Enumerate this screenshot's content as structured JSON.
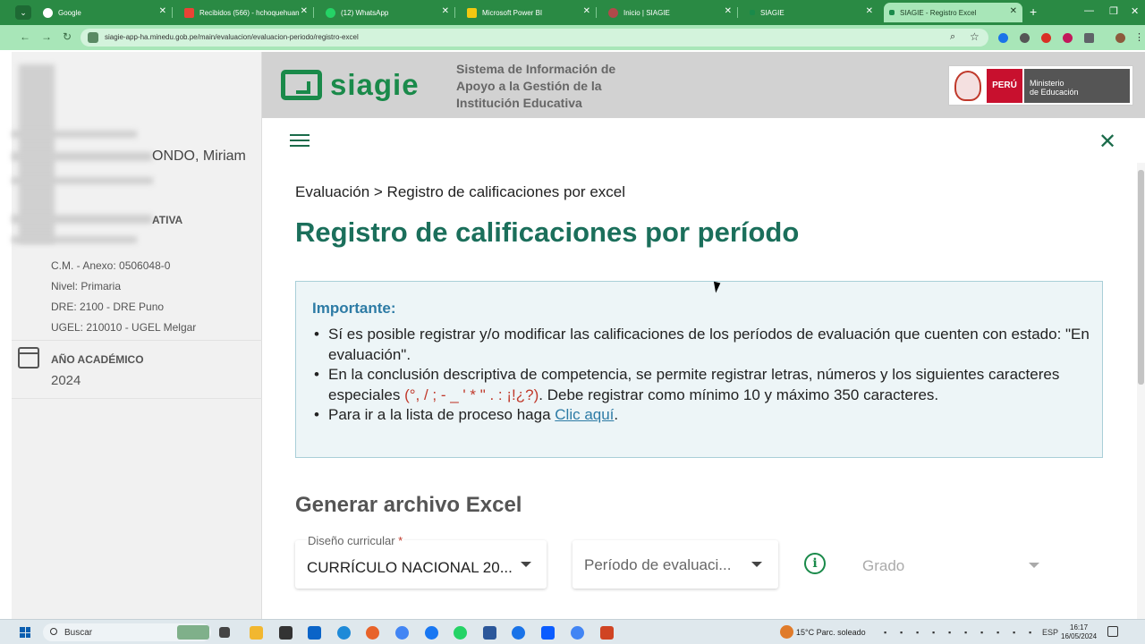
{
  "browser": {
    "tabs": [
      {
        "label": "Google",
        "color": "#4285f4"
      },
      {
        "label": "Recibidos (566) - hchoquehuan",
        "color": "#ea4335"
      },
      {
        "label": "(12) WhatsApp",
        "color": "#25d366"
      },
      {
        "label": "Microsoft Power BI",
        "color": "#f2c811"
      },
      {
        "label": "Inicio | SIAGIE",
        "color": "#c0392b"
      },
      {
        "label": "SIAGIE",
        "color": "#1a8a4a"
      },
      {
        "label": "SIAGIE - Registro Excel",
        "color": "#1a8a4a"
      }
    ],
    "url": "siagie-app-ha.minedu.gob.pe/main/evaluacion/evaluacion-periodo/registro-excel"
  },
  "sidebar": {
    "name_suffix": "ONDO, Miriam",
    "inst_suffix": "ATIVA",
    "cm": "C.M. - Anexo: 0506048-0",
    "nivel": "Nivel: Primaria",
    "dre": "DRE: 2100 - DRE Puno",
    "ugel": "UGEL: 210010 - UGEL Melgar",
    "year_label": "AÑO ACADÉMICO",
    "year": "2024"
  },
  "header": {
    "logo": "siagie",
    "system_title": "Sistema de Información de Apoyo a la Gestión de la Institución Educativa",
    "peru": "PERÚ",
    "ministerio_1": "Ministerio",
    "ministerio_2": "de Educación"
  },
  "main": {
    "breadcrumb": "Evaluación > Registro de calificaciones por excel",
    "title": "Registro de calificaciones por período",
    "notice": {
      "title": "Importante:",
      "item1": "Sí es posible registrar y/o modificar las calificaciones de los períodos de evaluación que cuenten con estado: \"En evaluación\".",
      "item2_a": "En la conclusión descriptiva de competencia, se permite registrar letras, números y los siguientes caracteres especiales ",
      "item2_special": "(°, / ; - _ ' * \" . : ¡!¿?)",
      "item2_b": ". Debe registrar como mínimo 10 y máximo 350 caracteres.",
      "item3_a": "Para ir a la lista de proceso haga ",
      "item3_link": "Clic aquí",
      "item3_b": "."
    },
    "section_title": "Generar archivo Excel",
    "form": {
      "diseno_label": "Diseño curricular",
      "diseno_required": "*",
      "diseno_value": "CURRÍCULO NACIONAL 20...",
      "periodo_placeholder": "Período de evaluaci...",
      "grado_placeholder": "Grado"
    }
  },
  "taskbar": {
    "search": "Buscar",
    "weather": "15°C  Parc. soleado",
    "lang": "ESP",
    "time": "16:17",
    "date": "16/05/2024"
  }
}
